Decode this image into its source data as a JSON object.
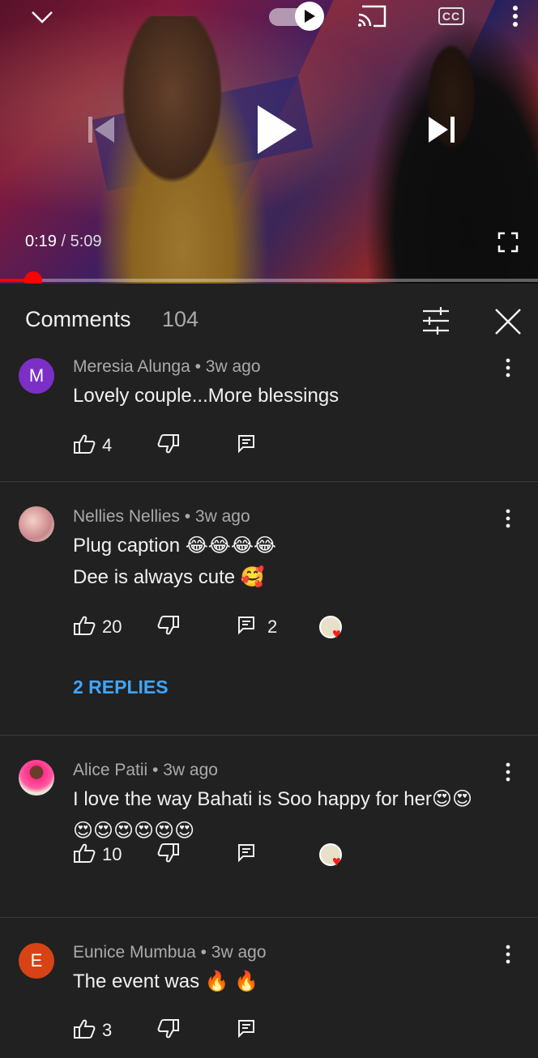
{
  "player": {
    "current_time": "0:19",
    "separator": " / ",
    "duration": "5:09",
    "progress_fraction": 0.062
  },
  "comments_panel": {
    "title": "Comments",
    "count": "104"
  },
  "comments": [
    {
      "avatar_letter": "M",
      "avatar_color": "#7b2fc7",
      "author": "Meresia Alunga",
      "age": "3w ago",
      "lines": [
        "Lovely couple...More blessings"
      ],
      "likes": "4",
      "reply_count": ""
    },
    {
      "avatar_letter": "",
      "avatar_color": "#d9c3c3",
      "author": "Nellies Nellies",
      "age": "3w ago",
      "lines": [
        "Plug caption 😂😂😂😂",
        "Dee is always cute 🥰"
      ],
      "likes": "20",
      "reply_count": "2",
      "creator_heart": true,
      "replies_label": "2 REPLIES"
    },
    {
      "avatar_letter": "",
      "avatar_color": "#f2a0b8",
      "author": "Alice Patii",
      "age": "3w ago",
      "lines": [
        "I love the way Bahati is Soo happy for her😍😍",
        "😍😍😍😍😍😍"
      ],
      "likes": "10",
      "reply_count": "",
      "creator_heart": true
    },
    {
      "avatar_letter": "E",
      "avatar_color": "#d84315",
      "author": "Eunice Mumbua",
      "age": "3w ago",
      "lines": [
        "The event was 🔥 🔥"
      ],
      "likes": "3",
      "reply_count": ""
    }
  ],
  "meta_separator": " • "
}
